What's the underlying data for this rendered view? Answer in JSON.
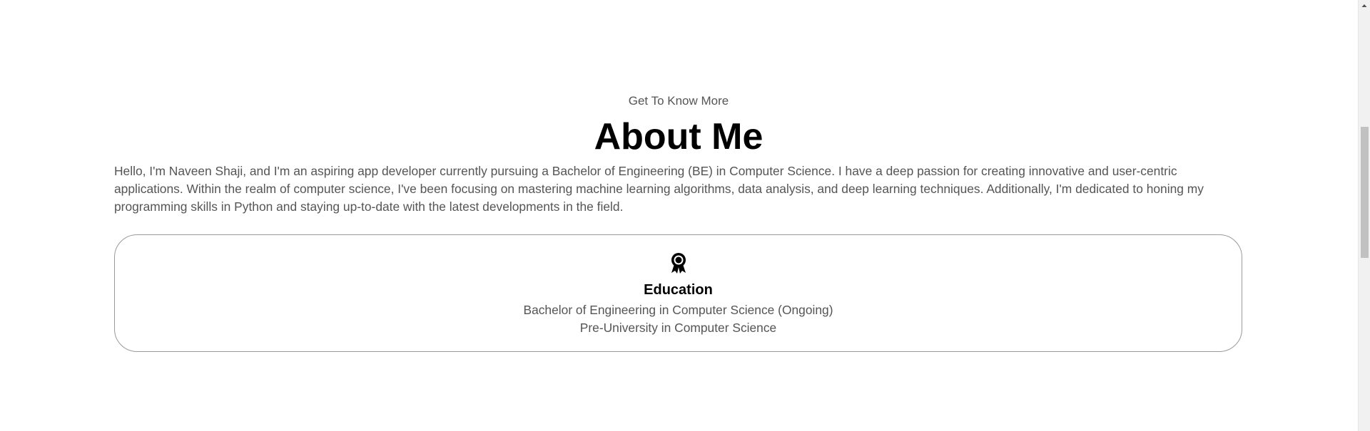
{
  "about": {
    "subtitle": "Get To Know More",
    "title": "About Me",
    "paragraph": "Hello, I'm Naveen Shaji, and I'm an aspiring app developer currently pursuing a Bachelor of Engineering (BE) in Computer Science. I have a deep passion for creating innovative and user-centric applications. Within the realm of computer science, I've been focusing on mastering machine learning algorithms, data analysis, and deep learning techniques. Additionally, I'm dedicated to honing my programming skills in Python and staying up-to-date with the latest developments in the field."
  },
  "education": {
    "icon": "education-award-icon",
    "title": "Education",
    "lines": [
      "Bachelor of Engineering in Computer Science (Ongoing)",
      "Pre-University in Computer Science"
    ]
  },
  "colors": {
    "background": "#ffffff",
    "heading": "#000000",
    "body_text": "#555555",
    "card_border": "#9a9a9a",
    "scrollbar_track": "#f1f1f1",
    "scrollbar_thumb": "#c1c1c1"
  }
}
